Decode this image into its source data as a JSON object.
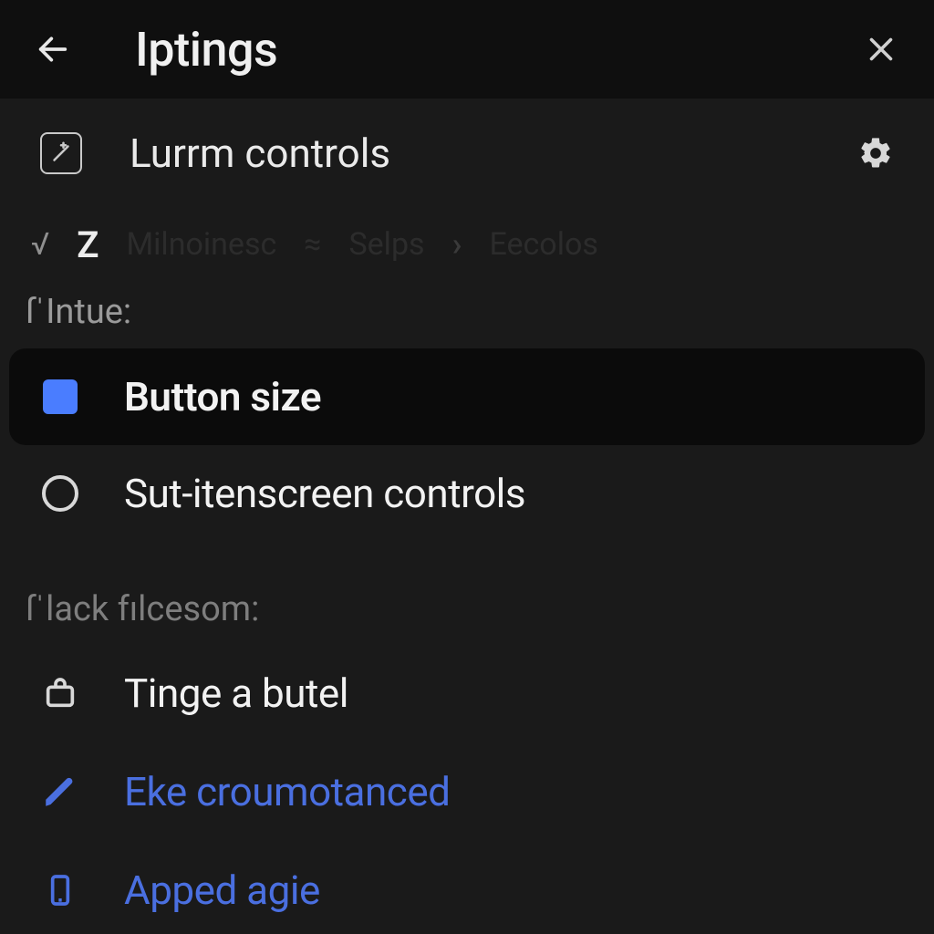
{
  "header": {
    "title": "Iptings"
  },
  "section": {
    "title": "Lurrm controls"
  },
  "toolbar": {
    "glyph": "√",
    "z": "Z",
    "crumb1": "Milnoinesc",
    "sep": "≈",
    "crumb2": "Selps",
    "crumb3": "Eecolos"
  },
  "groups": {
    "intue": {
      "label": "ſˈIntue:",
      "items": [
        {
          "label": "Button size"
        },
        {
          "label": "Sut-itenscreen controls"
        }
      ]
    },
    "flack": {
      "label": "ſˈlack fılcesom:",
      "items": [
        {
          "label": "Tinge a butel"
        },
        {
          "label": "Eke croumotanced"
        },
        {
          "label": "Apped agie"
        }
      ]
    }
  }
}
